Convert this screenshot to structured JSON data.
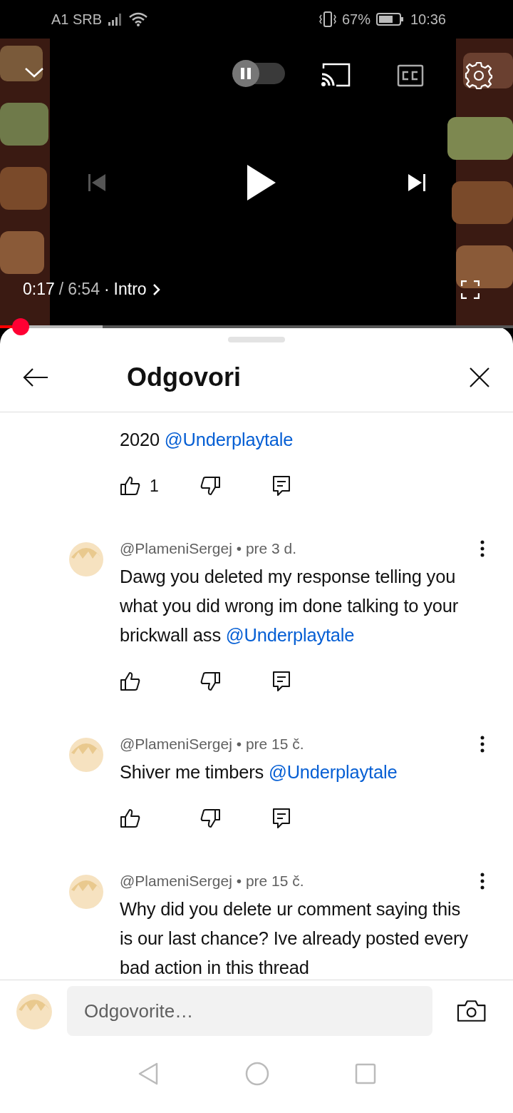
{
  "status_bar": {
    "carrier": "A1 SRB",
    "battery": "67%",
    "time": "10:36"
  },
  "player": {
    "current_time": "0:17",
    "separator": "/",
    "duration": "6:54",
    "dot": "·",
    "chapter": "Intro",
    "autoplay": {
      "on": false
    },
    "progress": {
      "level": 0.04
    },
    "buffer": {
      "level": 0.2
    }
  },
  "panel": {
    "title": "Odgovori"
  },
  "comments": [
    {
      "kind": "partial",
      "text": "2020",
      "mention": "@Underplaytale",
      "likes": "1"
    },
    {
      "kind": "full",
      "meta": "@PlameniSergej • pre 3 d.",
      "text": "Dawg you deleted my response telling you what you did wrong im done talking to your brickwall ass",
      "mention": "@Underplaytale"
    },
    {
      "kind": "full",
      "meta": "@PlameniSergej • pre 15 č.",
      "text": "Shiver me timbers ",
      "mention": "@Underplaytale"
    },
    {
      "kind": "cut",
      "meta": "@PlameniSergej • pre 15 č.",
      "text": "Why did you delete ur comment saying this is our last chance? Ive already posted every bad action in this thread"
    }
  ],
  "reply_field": {
    "placeholder": "Odgovorite…"
  }
}
